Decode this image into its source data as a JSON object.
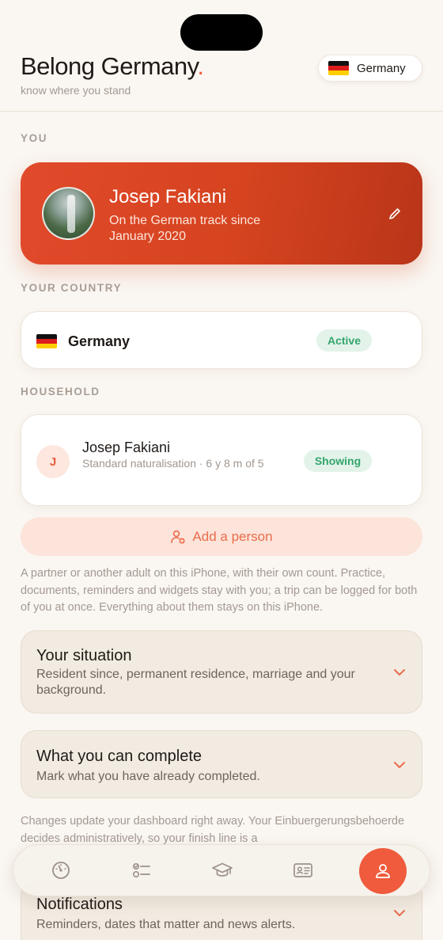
{
  "header": {
    "app_name": "Belong Germany",
    "app_name_dot": ".",
    "tagline": "know where you stand",
    "country_selector": "Germany"
  },
  "sections": {
    "you": "YOU",
    "your_country": "YOUR COUNTRY",
    "household": "HOUSEHOLD"
  },
  "profile": {
    "name": "Josep Fakiani",
    "subtitle": "On the German track since January 2020"
  },
  "country": {
    "name": "Germany",
    "status": "Active"
  },
  "household": {
    "member": {
      "initial": "J",
      "name": "Josep Fakiani",
      "meta": "Standard naturalisation · 6 y 8 m of 5",
      "status": "Showing"
    },
    "add_person_label": "Add a person",
    "helper_text": "A partner or another adult on this iPhone, with their own count. Practice, documents, reminders and widgets stay with you; a trip can be logged for both of you at once. Everything about them stays on this iPhone."
  },
  "accordions": [
    {
      "title": "Your situation",
      "description": "Resident since, permanent residence, marriage and your background."
    },
    {
      "title": "What you can complete",
      "description": "Mark what you have already completed."
    },
    {
      "title": "Notifications",
      "description": "Reminders, dates that matter and news alerts."
    }
  ],
  "note_text": "Changes update your dashboard right away. Your Einbuergerungsbehoerde decides administratively, so your finish line is a",
  "tabs": [
    {
      "icon": "gauge-icon"
    },
    {
      "icon": "checklist-icon"
    },
    {
      "icon": "graduation-cap-icon"
    },
    {
      "icon": "id-card-icon"
    },
    {
      "icon": "person-icon",
      "active": true
    }
  ],
  "colors": {
    "accent": "#ef5b3c",
    "background": "#faf6f1",
    "success": "#34a56b"
  }
}
